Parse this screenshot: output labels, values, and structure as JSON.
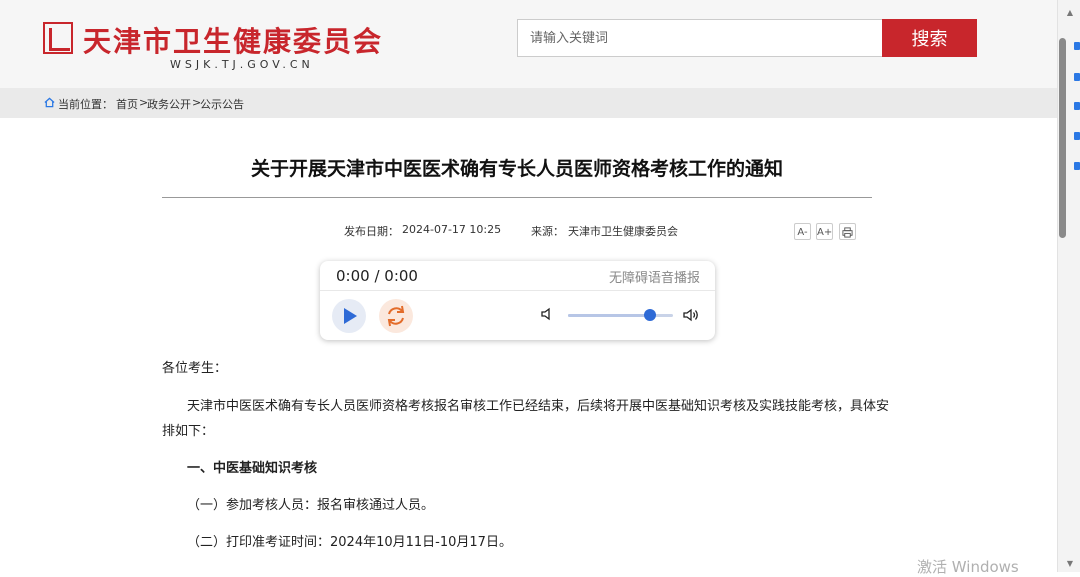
{
  "header": {
    "site_title": "天津市卫生健康委员会",
    "domain": "WSJK.TJ.GOV.CN",
    "search_placeholder": "请输入关键词",
    "search_button": "搜索"
  },
  "breadcrumb": {
    "label": "当前位置：",
    "items": [
      "首页",
      "政务公开",
      "公示公告"
    ],
    "separator": ">"
  },
  "article": {
    "title": "关于开展天津市中医医术确有专长人员医师资格考核工作的通知",
    "date_label": "发布日期：",
    "date": "2024-07-17 10:25",
    "source_label": "来源：",
    "source": "天津市卫生健康委员会",
    "tools": [
      "A-",
      "A+",
      "print"
    ]
  },
  "audio": {
    "time": "0:00 / 0:00",
    "caption": "无障碍语音播报",
    "volume_fraction": 0.78
  },
  "body": {
    "salutation": "各位考生：",
    "intro_line1": "天津市中医医术确有专长人员医师资格考核报名审核工作已经结束，后续将开展中医基础知识考核及实践技能考核，具体安",
    "intro_line2": "排如下：",
    "section1_heading": "一、中医基础知识考核",
    "item1": "（一）参加考核人员：报名审核通过人员。",
    "item2": "（二）打印准考证时间：2024年10月11日-10月17日。"
  },
  "watermark": "激活 Windows",
  "colors": {
    "brand_red": "#c8262c",
    "play_blue": "#2e6ad6",
    "replay_orange": "#e36c2a"
  }
}
